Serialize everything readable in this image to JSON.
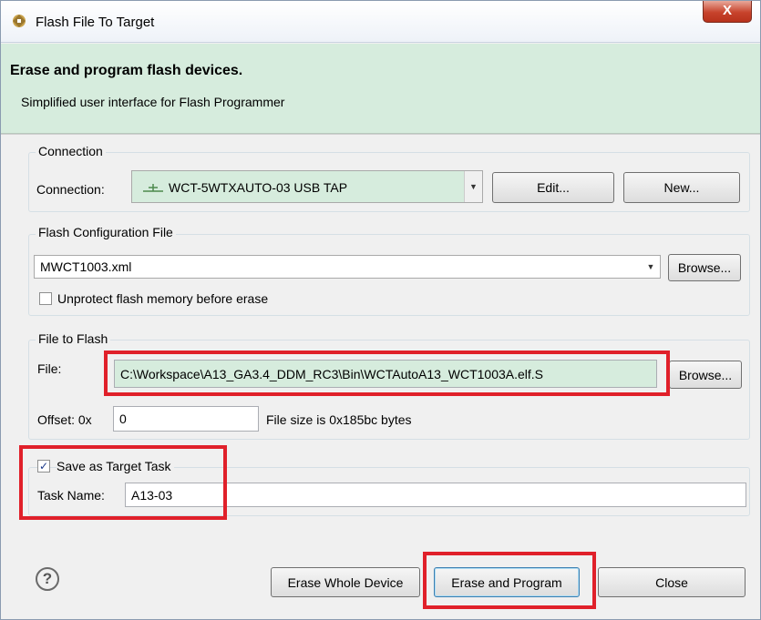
{
  "window": {
    "title": "Flash File To Target",
    "close_label": "X"
  },
  "header": {
    "title": "Erase and program flash devices.",
    "subtitle": "Simplified user interface for Flash Programmer"
  },
  "connection": {
    "group_label": "Connection",
    "field_label": "Connection:",
    "selected": "WCT-5WTXAUTO-03 USB TAP",
    "edit_label": "Edit...",
    "new_label": "New..."
  },
  "flash_config": {
    "group_label": "Flash Configuration File",
    "selected": "MWCT1003.xml",
    "browse_label": "Browse...",
    "unprotect_label": "Unprotect flash memory before erase",
    "unprotect_checked": false
  },
  "file_to_flash": {
    "group_label": "File to Flash",
    "file_label": "File:",
    "file_value": "C:\\Workspace\\A13_GA3.4_DDM_RC3\\Bin\\WCTAutoA13_WCT1003A.elf.S",
    "browse_label": "Browse...",
    "offset_label": "Offset: 0x",
    "offset_value": "0",
    "file_size_text": "File size is 0x185bc bytes"
  },
  "target_task": {
    "save_label": "Save as Target Task",
    "save_checked": true,
    "task_name_label": "Task Name:",
    "task_name_value": "A13-03"
  },
  "footer": {
    "erase_whole_label": "Erase Whole Device",
    "erase_program_label": "Erase and Program",
    "close_label": "Close",
    "help_glyph": "?"
  },
  "colors": {
    "banner": "#d6ecdd",
    "highlight": "#e0202a",
    "field_green": "#d6ecdd"
  }
}
